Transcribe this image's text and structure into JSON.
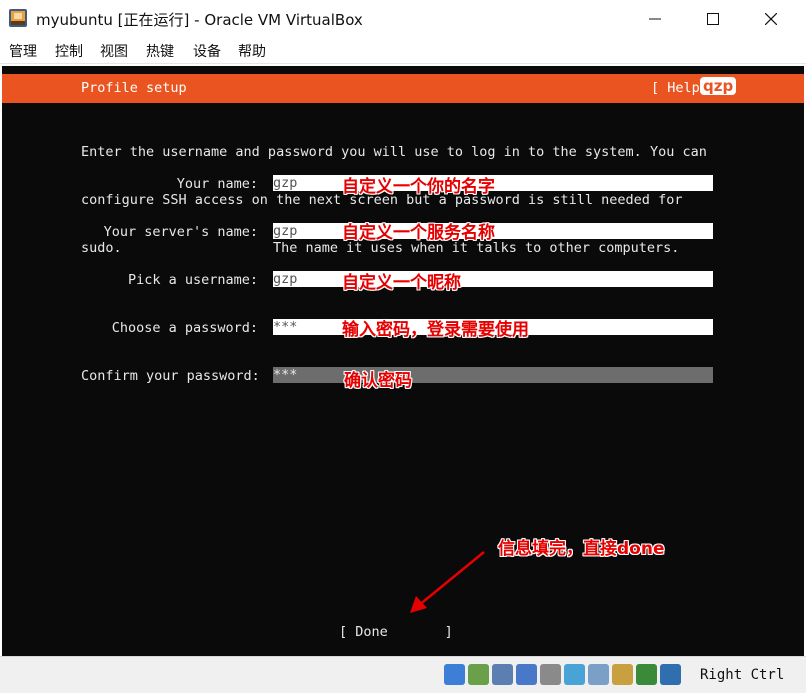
{
  "window": {
    "title": "myubuntu [正在运行] - Oracle VM VirtualBox",
    "icon": "virtualbox-icon"
  },
  "menubar": {
    "items": [
      "管理",
      "控制",
      "视图",
      "热键",
      "设备",
      "帮助"
    ]
  },
  "installer": {
    "header_title": "Profile setup",
    "help_label": "[ Help ]",
    "intro_lines": [
      "Enter the username and password you will use to log in to the system. You can",
      "configure SSH access on the next screen but a password is still needed for",
      "sudo."
    ],
    "fields": [
      {
        "label": "Your name:",
        "value": "gzp",
        "annotation": "自定义一个你的名字",
        "active": false
      },
      {
        "label": "Your server's name:",
        "value": "gzp",
        "annotation": "自定义一个服务名称",
        "active": false,
        "hint": "The name it uses when it talks to other computers."
      },
      {
        "label": "Pick a username:",
        "value": "gzp",
        "annotation": "自定义一个昵称",
        "active": false
      },
      {
        "label": "Choose a password:",
        "value": "***",
        "annotation": "输入密码，登录需要使用",
        "active": false
      },
      {
        "label": "Confirm your password:",
        "value": "***",
        "annotation": "确认密码",
        "active": true
      }
    ],
    "done_label": "[ Done       ]"
  },
  "annotations": {
    "help_badge": "qzp",
    "done_note": "信息填完，直接done"
  },
  "statusbar": {
    "host_key": "Right Ctrl"
  },
  "colors": {
    "ubuntu_orange": "#e95420",
    "annotation_red": "#e60000",
    "vm_background": "#0a0a0a"
  }
}
